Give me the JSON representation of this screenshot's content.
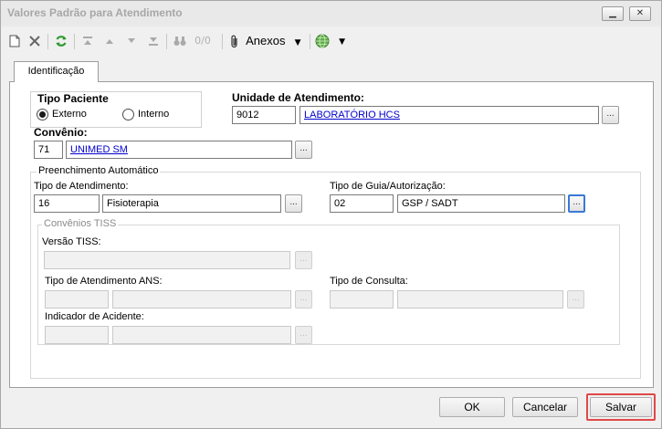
{
  "window": {
    "title": "Valores Padrão para Atendimento",
    "minimize_label": "▁",
    "close_label": "✕"
  },
  "toolbar": {
    "search_count": "0/0",
    "attachments_label": "Anexos"
  },
  "tab": {
    "label": "Identificação"
  },
  "form": {
    "patient_type": {
      "label": "Tipo Paciente",
      "options": [
        "Externo",
        "Interno"
      ],
      "selected": "Externo"
    },
    "service_unit": {
      "label": "Unidade de Atendimento:",
      "code": "9012",
      "name": "LABORATÓRIO HCS"
    },
    "agreement": {
      "label": "Convênio:",
      "code": "71",
      "name": "UNIMED SM"
    },
    "autofill": {
      "title": "Preenchimento Automático",
      "service_type": {
        "label": "Tipo de Atendimento:",
        "code": "16",
        "name": "Fisioterapia"
      },
      "guide_type": {
        "label": "Tipo de Guia/Autorização:",
        "code": "02",
        "name": "GSP / SADT"
      },
      "tiss": {
        "title": "Convênios TISS",
        "version_label": "Versão TISS:",
        "ans_type_label": "Tipo de Atendimento ANS:",
        "consult_type_label": "Tipo de Consulta:",
        "accident_label": "Indicador de Acidente:"
      }
    },
    "lookup_button_label": "..."
  },
  "footer": {
    "ok_label": "OK",
    "cancel_label": "Cancelar",
    "save_label": "Salvar"
  },
  "colors": {
    "link": "#0000cc",
    "focus": "#3b78d6",
    "highlight": "#e04848",
    "refresh_icon": "#2e9a2e"
  }
}
